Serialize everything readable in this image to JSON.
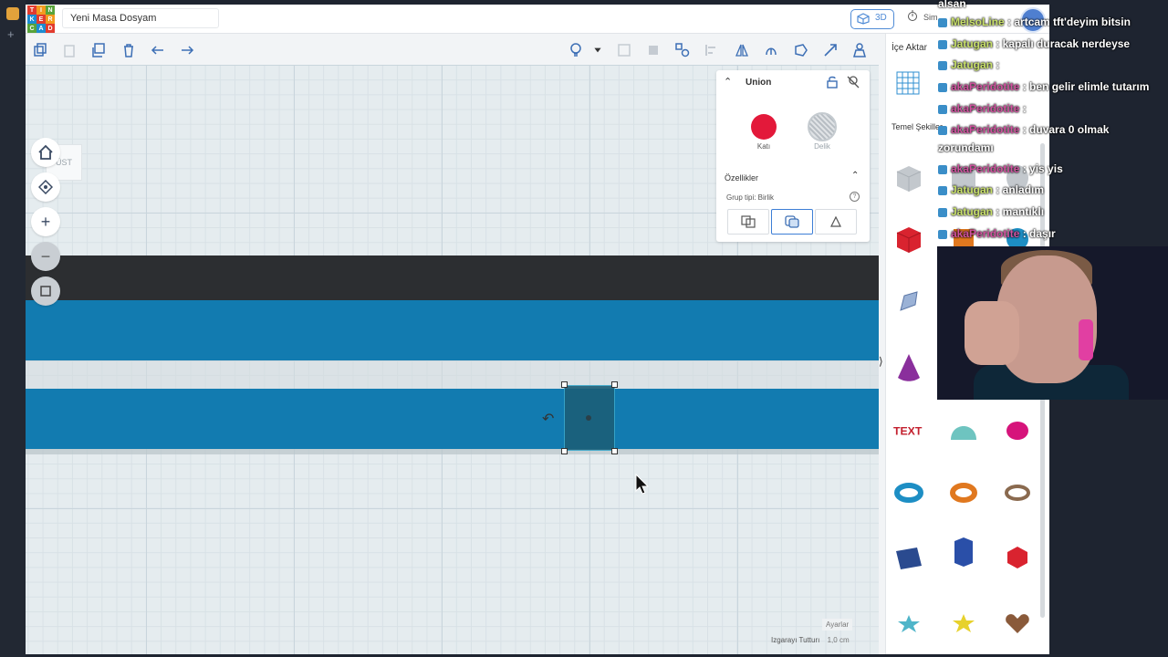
{
  "header": {
    "logo_letters": [
      "T",
      "I",
      "N",
      "K",
      "E",
      "R",
      "C",
      "A",
      "D"
    ],
    "logo_colors": [
      "#e23b2e",
      "#f39a1e",
      "#58a33a",
      "#1c8bd1",
      "#e23b2e",
      "#f39a1e",
      "#58a33a",
      "#1c8bd1",
      "#e23b2e"
    ],
    "doc_title": "Yeni Masa Dosyam",
    "view_3d_label": "3D",
    "sim_label": "Sim..."
  },
  "workplane": {
    "view_cube_label": "ÜST",
    "settings_label": "Ayarlar",
    "grid_label": "Izgarayı Tutturı",
    "grid_value": "1,0 cm"
  },
  "inspector": {
    "title": "Union",
    "solid_label": "Katı",
    "hole_label": "Delik",
    "properties_label": "Özellikler",
    "group_type_label": "Grup tipi: Birlik",
    "help_label": "?"
  },
  "right_panel": {
    "import_label": "İçe Aktar",
    "shapes_category": "Temel Şekiller",
    "expand_chevron": "⟩"
  },
  "chat": [
    {
      "user": "MelsoLine",
      "text": ": artcam tft'deyim bitsin",
      "color": "green"
    },
    {
      "user": "Jatugan",
      "text": ": kapalı duracak nerdeyse",
      "color": "green"
    },
    {
      "user": "Jatugan",
      "text": ":",
      "color": "green"
    },
    {
      "user": "akaPeridotite",
      "text": ": ben gelir elimle tutarım",
      "color": "pink"
    },
    {
      "user": "akaPeridotite",
      "text": ":",
      "color": "pink"
    },
    {
      "user": "akaPeridotite",
      "text": ": duvara 0 olmak",
      "color": "pink"
    },
    {
      "user": "",
      "text": "zorundamı",
      "color": "none"
    },
    {
      "user": "akaPeridotite",
      "text": ": yis yis",
      "color": "pink"
    },
    {
      "user": "Jatugan",
      "text": ": anladım",
      "color": "green"
    },
    {
      "user": "Jatugan",
      "text": ": mantıklı",
      "color": "green"
    },
    {
      "user": "akaPeridotite",
      "text": ": daşır",
      "color": "pink"
    }
  ],
  "chat_top_fragment": "alsan"
}
